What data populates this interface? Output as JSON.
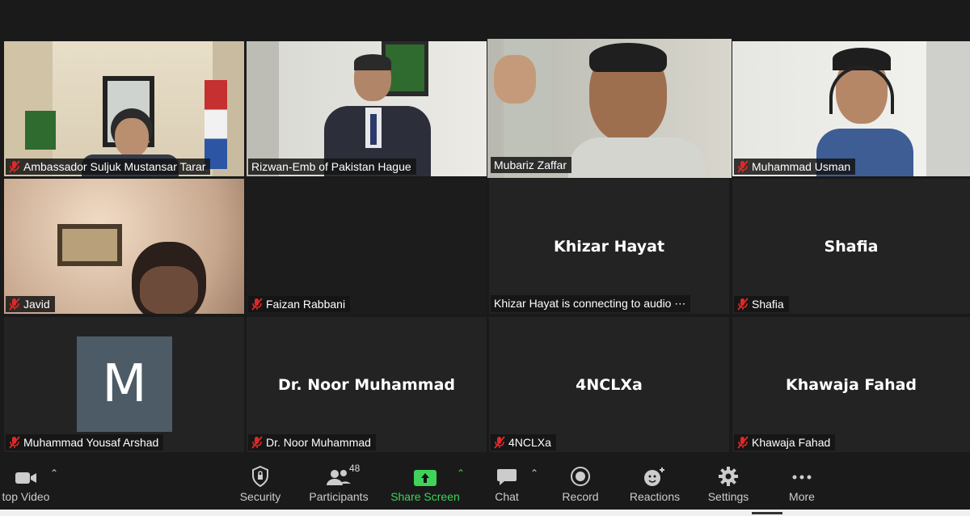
{
  "participants": [
    {
      "name": "Ambassador Suljuk Mustansar Tarar",
      "muted": true
    },
    {
      "name": "Rizwan-Emb of Pakistan Hague",
      "muted": false
    },
    {
      "name": "Mubariz Zaffar",
      "muted": false
    },
    {
      "name": "Muhammad Usman",
      "muted": true
    },
    {
      "name": "Javid",
      "muted": true
    },
    {
      "name": "Faizan Rabbani",
      "muted": true
    },
    {
      "name": "Khizar Hayat is connecting to audio ⋯",
      "display_name": "Khizar Hayat",
      "muted": false
    },
    {
      "name": "Shafia",
      "display_name": "Shafia",
      "muted": true
    },
    {
      "name": "Muhammad Yousaf Arshad",
      "avatar_letter": "M",
      "muted": true
    },
    {
      "name": "Dr. Noor Muhammad",
      "display_name": "Dr. Noor Muhammad",
      "muted": true
    },
    {
      "name": "4NCLXa",
      "display_name": "4NCLXa",
      "muted": true
    },
    {
      "name": "Khawaja Fahad",
      "display_name": "Khawaja Fahad",
      "muted": true
    }
  ],
  "toolbar": {
    "stop_video": "top Video",
    "security": "Security",
    "participants": "Participants",
    "participants_count": "48",
    "share_screen": "Share Screen",
    "chat": "Chat",
    "record": "Record",
    "reactions": "Reactions",
    "settings": "Settings",
    "more": "More"
  },
  "colors": {
    "active_speaker": "#a8d35a",
    "share_green": "#3fd35a",
    "mute_red": "#e02828",
    "avatar_bg": "#4c5b66"
  }
}
